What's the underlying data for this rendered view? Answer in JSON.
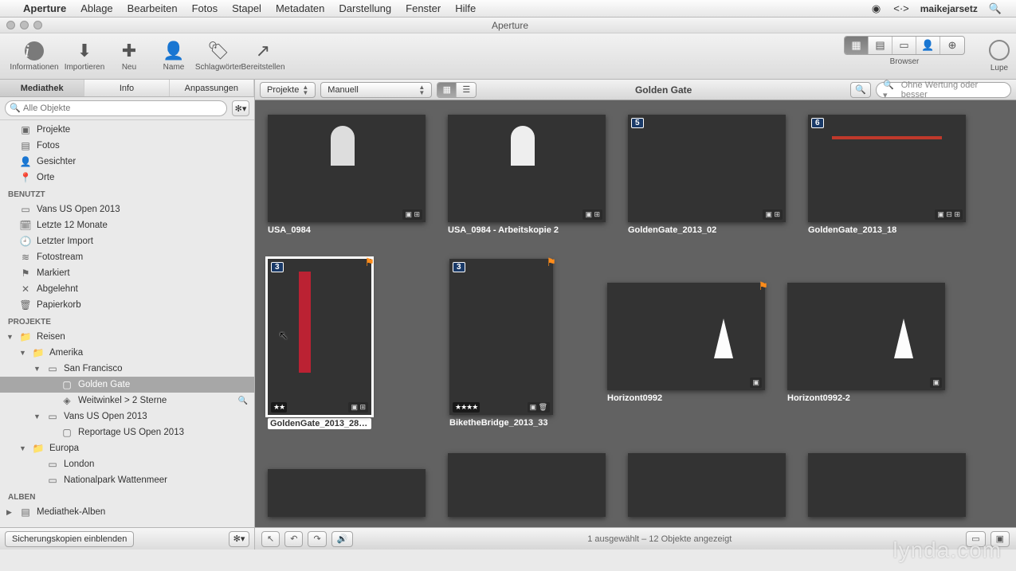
{
  "menubar": {
    "app": "Aperture",
    "items": [
      "Ablage",
      "Bearbeiten",
      "Fotos",
      "Stapel",
      "Metadaten",
      "Darstellung",
      "Fenster",
      "Hilfe"
    ],
    "user": "maikejarsetz"
  },
  "window": {
    "title": "Aperture"
  },
  "toolbar": {
    "info": "Informationen",
    "import": "Importieren",
    "new": "Neu",
    "name": "Name",
    "keywords": "Schlagwörter",
    "share": "Bereitstellen",
    "browser_label": "Browser",
    "loupe": "Lupe"
  },
  "sidebar": {
    "tabs": [
      "Mediathek",
      "Info",
      "Anpassungen"
    ],
    "search_placeholder": "Alle Objekte",
    "library": {
      "projects": "Projekte",
      "photos": "Fotos",
      "faces": "Gesichter",
      "places": "Orte"
    },
    "recent_header": "BENUTZT",
    "recent": [
      "Vans US Open 2013",
      "Letzte 12 Monate",
      "Letzter Import",
      "Fotostream",
      "Markiert",
      "Abgelehnt",
      "Papierkorb"
    ],
    "projects_header": "PROJEKTE",
    "tree": {
      "reisen": "Reisen",
      "amerika": "Amerika",
      "sanfrancisco": "San Francisco",
      "goldengate": "Golden Gate",
      "weitwinkel": "Weitwinkel > 2 Sterne",
      "vans": "Vans US Open 2013",
      "reportage": "Reportage US Open 2013",
      "europa": "Europa",
      "london": "London",
      "wattenmeer": "Nationalpark Wattenmeer"
    },
    "albums_header": "ALBEN",
    "albums_item": "Mediathek-Alben",
    "bottom_button": "Sicherungskopien einblenden"
  },
  "browser": {
    "scope_button": "Projekte",
    "sort_button": "Manuell",
    "title": "Golden Gate",
    "filter_placeholder": "Ohne Wertung oder besser"
  },
  "thumbs": [
    {
      "caption": "USA_0984",
      "kind": "cityhall-bw"
    },
    {
      "caption": "USA_0984 - Arbeitskopie 2",
      "kind": "cityhall"
    },
    {
      "caption": "GoldenGate_2013_02",
      "kind": "fog",
      "stack": "5"
    },
    {
      "caption": "GoldenGate_2013_18",
      "kind": "bridge-wide",
      "stack": "6"
    },
    {
      "caption": "GoldenGate_2013_28…",
      "kind": "bridge-tall",
      "stack": "3",
      "stars": "★★",
      "flag": true,
      "selected": true
    },
    {
      "caption": "BiketheBridge_2013_33",
      "kind": "biker",
      "stack": "3",
      "stars": "★★★★",
      "flag": true
    },
    {
      "caption": "Horizont0992",
      "kind": "alcatraz",
      "flag": true
    },
    {
      "caption": "Horizont0992-2",
      "kind": "alcatraz"
    }
  ],
  "status": {
    "text": "1 ausgewählt – 12 Objekte angezeigt"
  },
  "watermark": "lynda.com"
}
